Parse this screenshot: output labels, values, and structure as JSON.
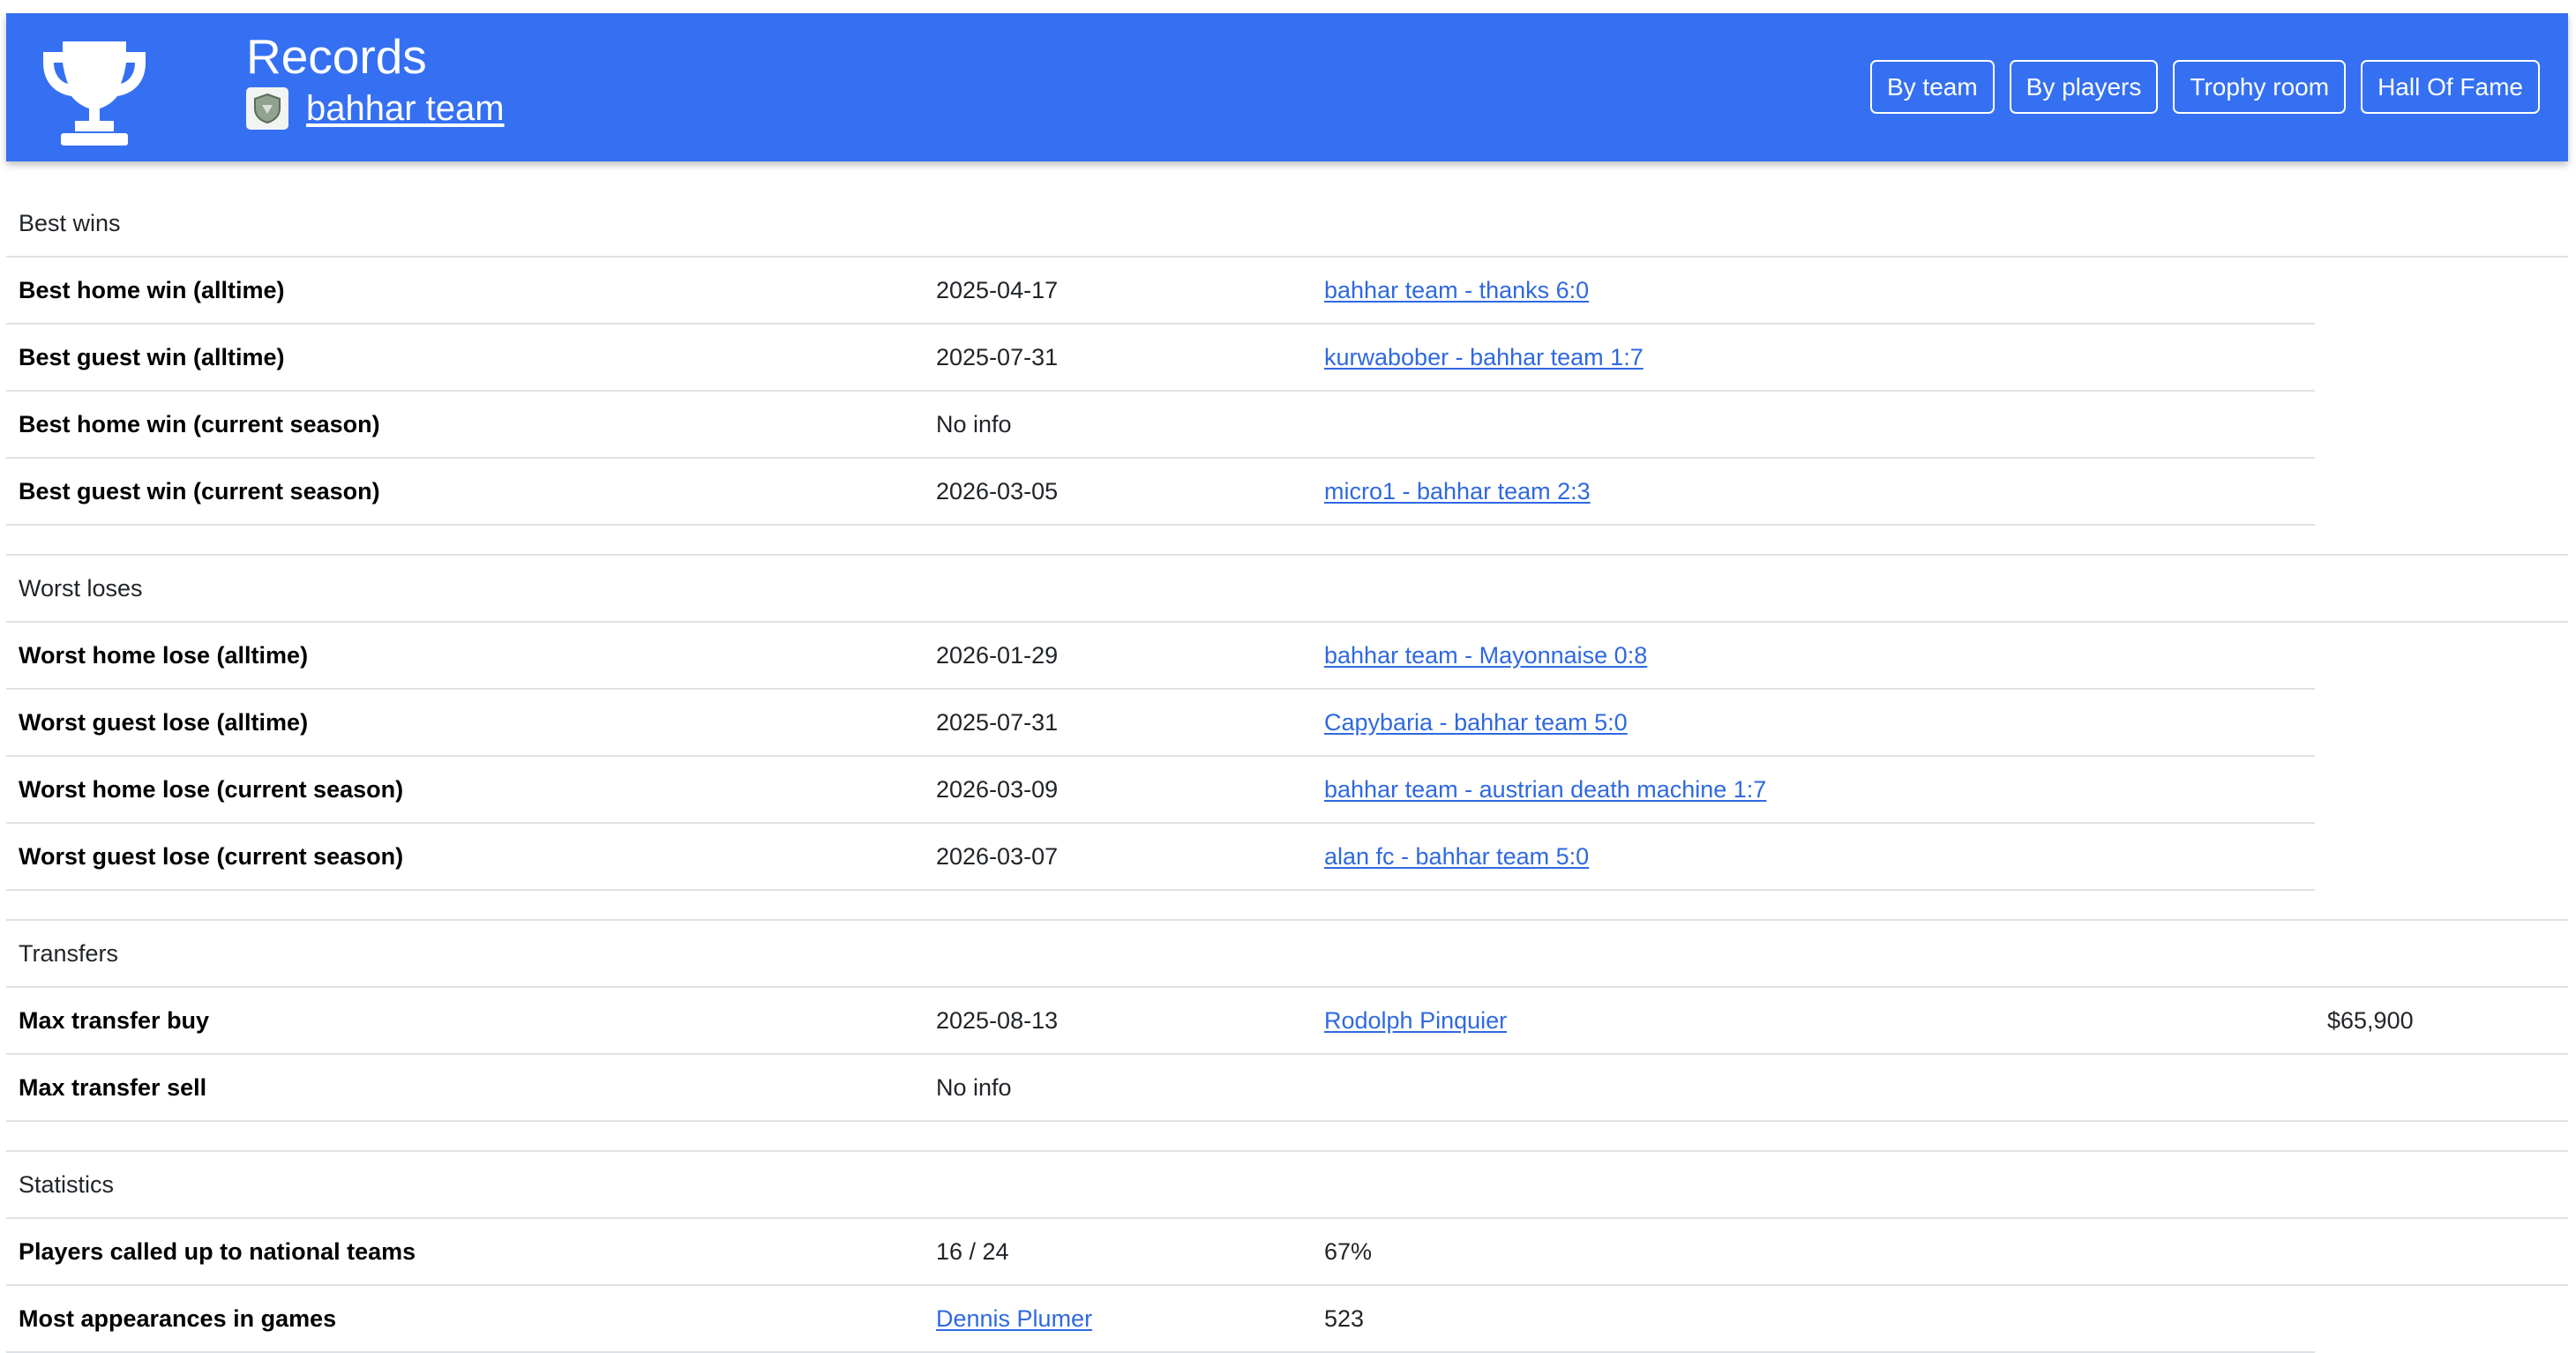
{
  "header": {
    "title": "Records",
    "team_name": "bahhar team",
    "nav": [
      "By team",
      "By players",
      "Trophy room",
      "Hall Of Fame"
    ]
  },
  "best_wins": {
    "heading": "Best wins",
    "rows": [
      {
        "label": "Best home win (alltime)",
        "date": "2025-04-17",
        "match": "bahhar team - thanks 6:0"
      },
      {
        "label": "Best guest win (alltime)",
        "date": "2025-07-31",
        "match": "kurwabober - bahhar team 1:7"
      },
      {
        "label": "Best home win (current season)",
        "date": "No info",
        "match": ""
      },
      {
        "label": "Best guest win (current season)",
        "date": "2026-03-05",
        "match": "micro1 - bahhar team 2:3"
      }
    ]
  },
  "worst_loses": {
    "heading": "Worst loses",
    "rows": [
      {
        "label": "Worst home lose (alltime)",
        "date": "2026-01-29",
        "match": "bahhar team - Mayonnaise 0:8"
      },
      {
        "label": "Worst guest lose (alltime)",
        "date": "2025-07-31",
        "match": "Capybaria - bahhar team 5:0"
      },
      {
        "label": "Worst home lose (current season)",
        "date": "2026-03-09",
        "match": "bahhar team - austrian death machine 1:7"
      },
      {
        "label": "Worst guest lose (current season)",
        "date": "2026-03-07",
        "match": "alan fc - bahhar team 5:0"
      }
    ]
  },
  "transfers": {
    "heading": "Transfers",
    "rows": [
      {
        "label": "Max transfer buy",
        "date": "2025-08-13",
        "player": "Rodolph Pinquier",
        "price": "$65,900"
      },
      {
        "label": "Max transfer sell",
        "date": "No info",
        "player": "",
        "price": ""
      }
    ]
  },
  "statistics": {
    "heading": "Statistics",
    "national": {
      "label": "Players called up to national teams",
      "count": "16 / 24",
      "percent": "67%"
    },
    "appearances": {
      "label": "Most appearances in games",
      "player": "Dennis Plumer",
      "games": "523"
    }
  },
  "colors": {
    "header_bg": "#3570f3",
    "link": "#2f69e0"
  }
}
